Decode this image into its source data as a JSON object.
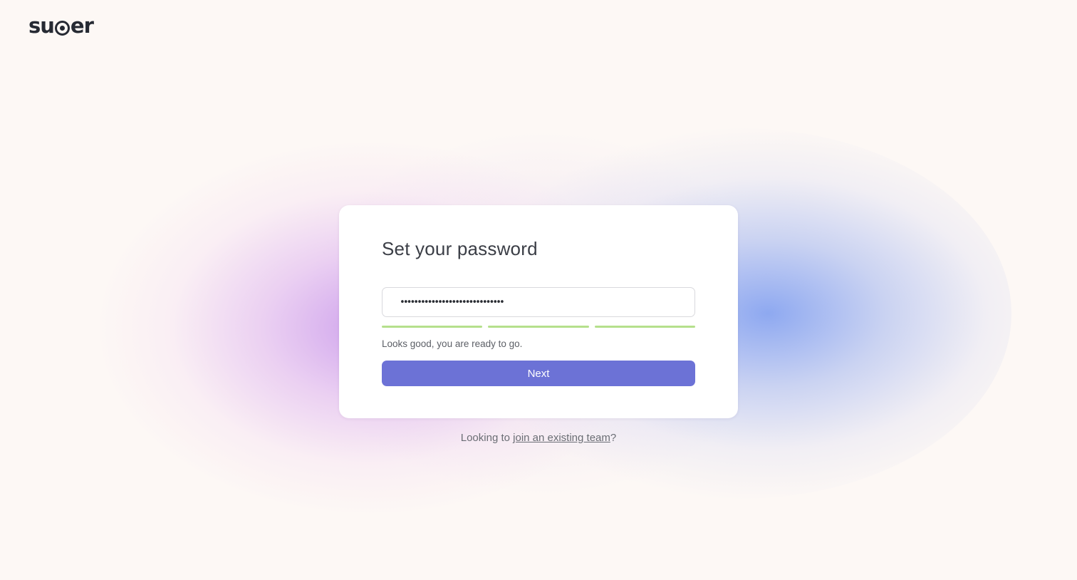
{
  "brand": {
    "logo_prefix": "su",
    "logo_suffix": "er",
    "logo_text": "super"
  },
  "card": {
    "title": "Set your password",
    "password_value": "••••••••••••••••••••••••••••••",
    "strength_segments_filled": 3,
    "strength_segments_total": 3,
    "hint": "Looks good, you are ready to go.",
    "next_label": "Next"
  },
  "footer": {
    "prefix": "Looking to ",
    "link_text": "join an existing team",
    "suffix": "?"
  },
  "colors": {
    "accent": "#6c72d6",
    "strength_ok": "#b5e08c",
    "background": "#fdf8f5"
  }
}
